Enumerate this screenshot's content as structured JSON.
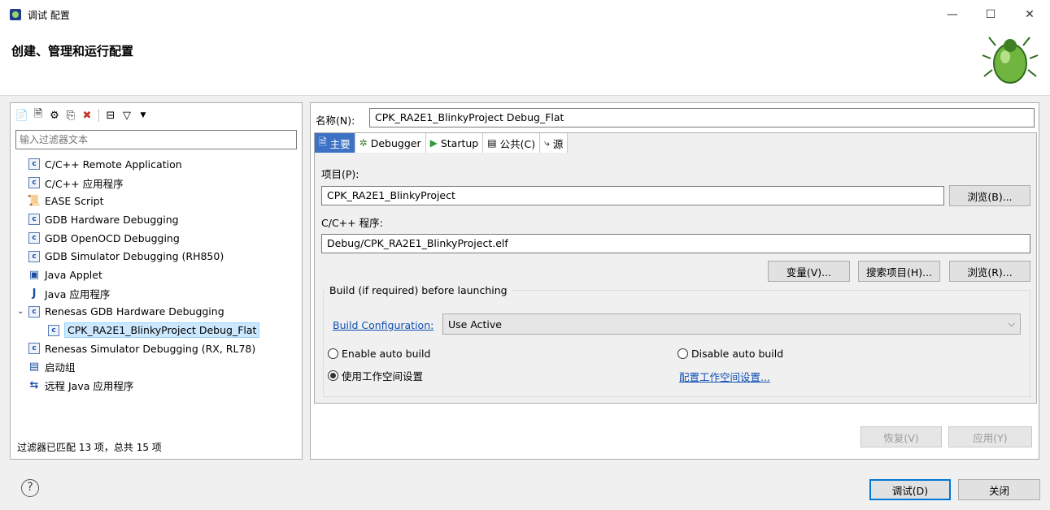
{
  "window": {
    "title": "调试 配置",
    "minimize_glyph": "—",
    "maximize_glyph": "☐",
    "close_glyph": "✕"
  },
  "header": {
    "title": "创建、管理和运行配置"
  },
  "left": {
    "filter_placeholder": "输入过滤器文本",
    "tree": [
      {
        "label": "C/C++ Remote Application",
        "icon": "c-icon"
      },
      {
        "label": "C/C++ 应用程序",
        "icon": "c-icon"
      },
      {
        "label": "EASE Script",
        "icon": "script-icon"
      },
      {
        "label": "GDB Hardware Debugging",
        "icon": "c-icon"
      },
      {
        "label": "GDB OpenOCD Debugging",
        "icon": "c-icon"
      },
      {
        "label": "GDB Simulator Debugging (RH850)",
        "icon": "c-icon"
      },
      {
        "label": "Java Applet",
        "icon": "applet-icon"
      },
      {
        "label": "Java 应用程序",
        "icon": "java-icon"
      },
      {
        "label": "Renesas GDB Hardware Debugging",
        "icon": "c-icon",
        "expanded": true
      },
      {
        "label": "CPK_RA2E1_BlinkyProject Debug_Flat",
        "icon": "c-icon",
        "child": true,
        "selected": true
      },
      {
        "label": "Renesas Simulator Debugging (RX, RL78)",
        "icon": "c-icon"
      },
      {
        "label": "启动组",
        "icon": "launch-group-icon"
      },
      {
        "label": "远程 Java 应用程序",
        "icon": "remote-java-icon"
      }
    ],
    "status": "过滤器已匹配 13 项，总共 15 项"
  },
  "right": {
    "name_label": "名称(N):",
    "name_value": "CPK_RA2E1_BlinkyProject Debug_Flat",
    "tabs": [
      {
        "label": "主要",
        "icon": "main-tab-icon",
        "active": true
      },
      {
        "label": "Debugger",
        "icon": "debugger-tab-icon"
      },
      {
        "label": "Startup",
        "icon": "startup-tab-icon"
      },
      {
        "label": "公共(C)",
        "icon": "common-tab-icon"
      },
      {
        "label": "源",
        "icon": "source-tab-icon"
      }
    ],
    "project_label": "项目(P):",
    "project_value": "CPK_RA2E1_BlinkyProject",
    "browse_project": "浏览(B)...",
    "program_label": "C/C++ 程序:",
    "program_value": "Debug/CPK_RA2E1_BlinkyProject.elf",
    "variables_button": "变量(V)...",
    "search_project_button": "搜索项目(H)...",
    "browse_program": "浏览(R)...",
    "build_group_title": "Build (if required) before launching",
    "build_config_link": "Build Configuration:",
    "build_config_value": "Use Active",
    "radio_enable": "Enable auto build",
    "radio_disable": "Disable auto build",
    "radio_workspace": "使用工作空间设置",
    "workspace_link": "配置工作空间设置...",
    "revert_button": "恢复(V)",
    "apply_button": "应用(Y)"
  },
  "footer": {
    "help_glyph": "?",
    "debug_button": "调试(D)",
    "close_button": "关闭"
  }
}
